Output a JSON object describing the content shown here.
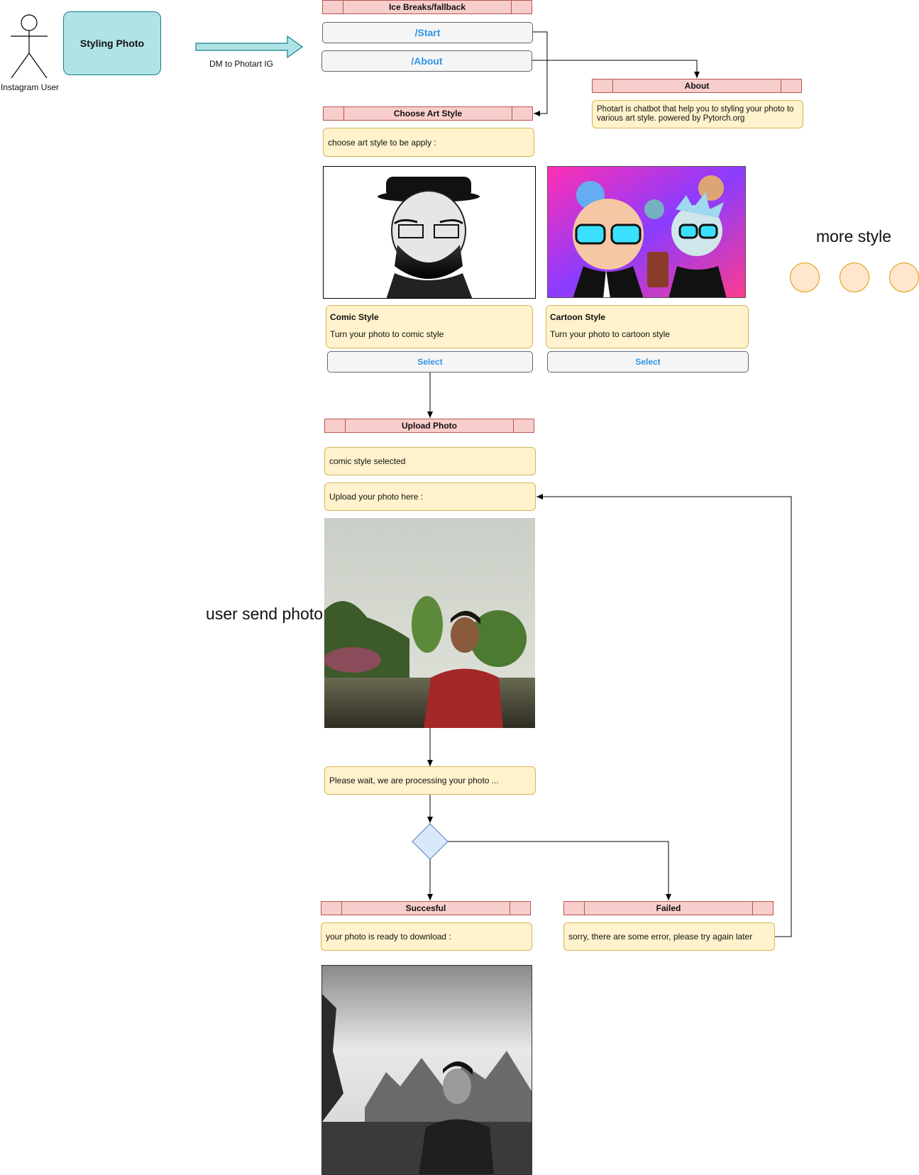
{
  "actor": {
    "label": "Instagram User"
  },
  "feature": {
    "label": "Styling Photo"
  },
  "dm": {
    "label": "DM to Photart IG"
  },
  "icebreaks": {
    "header": "Ice Breaks/fallback",
    "start": "/Start",
    "about": "/About"
  },
  "about": {
    "header": "About",
    "text": "Photart is chatbot that help you to styling your photo to various art style. powered by Pytorch.org"
  },
  "choose": {
    "header": "Choose Art Style",
    "prompt": "choose art style to be apply :"
  },
  "styles": [
    {
      "title": "Comic Style",
      "desc": "Turn your photo to comic style",
      "button": "Select"
    },
    {
      "title": "Cartoon Style",
      "desc": "Turn your photo to cartoon style",
      "button": "Select"
    }
  ],
  "more": {
    "label": "more style"
  },
  "upload": {
    "header": "Upload Photo",
    "selected": "comic style selected",
    "prompt": "Upload your photo here :"
  },
  "user_send": {
    "label": "user send photo"
  },
  "processing": {
    "text": "Please wait, we are processing your photo ..."
  },
  "success": {
    "header": "Succesful",
    "text": "your photo is ready to download :"
  },
  "failed": {
    "header": "Failed",
    "text": "sorry, there are some error, please try again later"
  },
  "colors": {
    "header_fill": "#f8cecc",
    "header_stroke": "#b85450",
    "message_fill": "#fff2cc",
    "message_stroke": "#d6b656",
    "button_fill": "#f5f5f5",
    "button_text": "#2e95e8",
    "feature_fill": "#b0e3e6",
    "feature_stroke": "#0e8088",
    "decision_fill": "#dae8fc",
    "decision_stroke": "#6c8ebf",
    "dot_fill": "#ffe6cc",
    "dot_stroke": "#d79b00"
  },
  "icons": {
    "actor": "stick-figure-icon",
    "dm_arrow": "block-arrow-right-icon",
    "decision": "diamond-icon"
  }
}
